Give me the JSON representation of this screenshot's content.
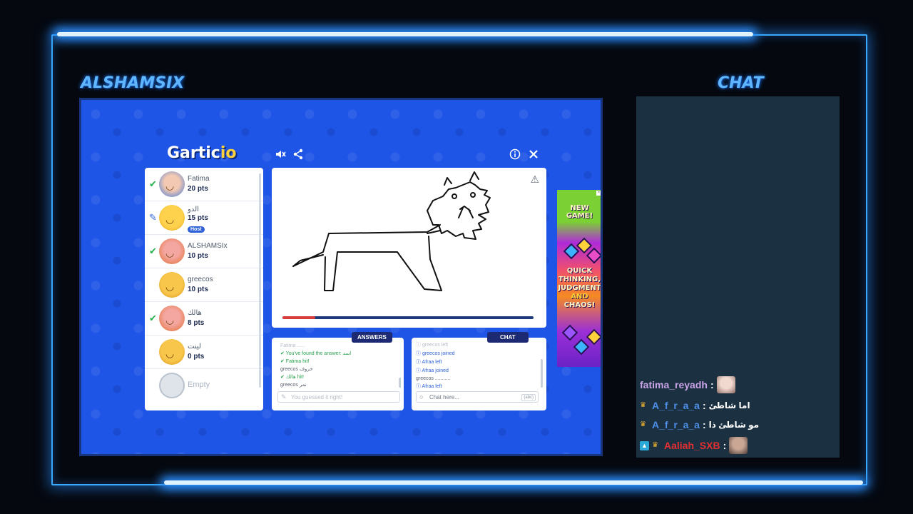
{
  "overlay": {
    "left_title": "ALSHAMSIX",
    "right_title": "CHAT"
  },
  "game": {
    "logo_main": "Gartic",
    "logo_suffix": "io",
    "players": [
      {
        "name": "Fatima",
        "points": "20 pts",
        "status": "guessed"
      },
      {
        "name": "الدو",
        "points": "15 pts",
        "status": "drawing",
        "badge": "Host"
      },
      {
        "name": "ALSHAMSIx",
        "points": "10 pts",
        "status": "guessed"
      },
      {
        "name": "greecos",
        "points": "10 pts",
        "status": "none"
      },
      {
        "name": "هالك",
        "points": "8 pts",
        "status": "guessed"
      },
      {
        "name": "لينت",
        "points": "0 pts",
        "status": "none"
      }
    ],
    "empty_slot": "Empty",
    "timer_progress": 0.13,
    "answers_tab": "ANSWERS",
    "chat_tab": "CHAT",
    "answers": [
      {
        "text": "Fatima ......",
        "kind": "faded"
      },
      {
        "text": "✔ You've found the answer: اسد",
        "kind": "green"
      },
      {
        "text": "✔ Fatima hit!",
        "kind": "green"
      },
      {
        "text": "greecos خروف",
        "kind": "grey"
      },
      {
        "text": "✔ هالك hit!",
        "kind": "green"
      },
      {
        "text": "greecos نمر",
        "kind": "grey"
      }
    ],
    "answers_input_text": "You guessed it right!",
    "chat_messages": [
      {
        "text": "ⓘ greecos left",
        "kind": "faded"
      },
      {
        "text": "ⓘ greecos joined",
        "kind": "blue"
      },
      {
        "text": "ⓘ Afraa left",
        "kind": "blue"
      },
      {
        "text": "ⓘ Afraa joined",
        "kind": "blue"
      },
      {
        "text": "greecos ...........",
        "kind": "grey"
      },
      {
        "text": "ⓘ Afraa left",
        "kind": "blue"
      }
    ],
    "chat_placeholder": "Chat here...",
    "chat_counter": "(abc)"
  },
  "ad": {
    "line1": "NEW",
    "line2": "GAME!",
    "line3": "QUICK",
    "line4": "THINKING,",
    "line5": "JUDGMENT",
    "line6": "AND",
    "line7": "CHAOS!"
  },
  "stream_chat": [
    {
      "user": "fatima_reyadh",
      "color": "#c9a3e6",
      "message": "",
      "emote": true,
      "badges": []
    },
    {
      "user": "A_f_r_a_a",
      "color": "#4d8fe8",
      "message": "اما شاطئ",
      "emote": false,
      "badges": [
        "crown"
      ]
    },
    {
      "user": "A_f_r_a_a",
      "color": "#4d8fe8",
      "message": "مو شاطئ ذا",
      "emote": false,
      "badges": [
        "crown"
      ]
    },
    {
      "user": "Aaliah_SXB",
      "color": "#e03030",
      "message": "",
      "emote": true,
      "badges": [
        "prime",
        "crown"
      ]
    }
  ]
}
